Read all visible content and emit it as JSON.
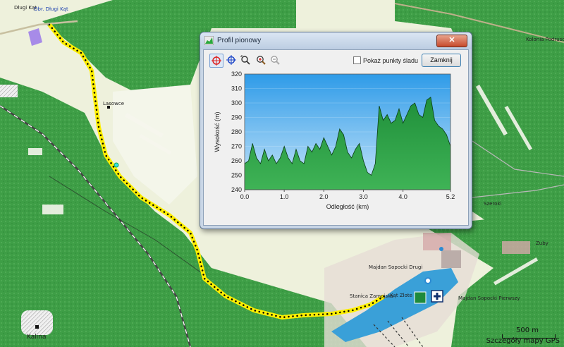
{
  "map": {
    "places": [
      {
        "name": "Długi Kąt",
        "blue": false
      },
      {
        "name": "Obr. Długi Kąt",
        "blue": true
      },
      {
        "name": "Kolonia Podrusow",
        "blue": false
      },
      {
        "name": "Lasowce",
        "blue": false
      },
      {
        "name": "Zuby",
        "blue": false
      },
      {
        "name": "Majdan Sopocki Drugi",
        "blue": false
      },
      {
        "name": "Stanica Zamojska",
        "blue": false
      },
      {
        "name": "Kąt Zlote",
        "blue": false
      },
      {
        "name": "Majdan Sopocki Pierwszy",
        "blue": false
      },
      {
        "name": "Kalina",
        "blue": false
      },
      {
        "name": "Szeroki",
        "blue": false
      }
    ],
    "scale_label": "500 m",
    "status": "Szczegóły mapy GPS"
  },
  "dialog": {
    "title": "Profil pionowy",
    "close_symbol": "✕",
    "show_points_label": "Pokaż punkty śladu",
    "show_points_checked": false,
    "close_button": "Zamknij",
    "tools": [
      "select-tool-icon",
      "pan-tool-icon",
      "zoom-box-icon",
      "zoom-in-icon",
      "zoom-out-icon"
    ]
  },
  "chart_data": {
    "type": "area",
    "xlabel": "Odległość   (km)",
    "ylabel": "Wysokość (m)",
    "xlim": [
      0,
      5.2
    ],
    "ylim": [
      240,
      320
    ],
    "xticks": [
      "0.0",
      "1.0",
      "2.0",
      "3.0",
      "4.0",
      "5.2"
    ],
    "yticks": [
      "240",
      "250",
      "260",
      "270",
      "280",
      "290",
      "300",
      "310",
      "320"
    ],
    "grid": true,
    "series": [
      {
        "x": [
          0,
          0.1,
          0.2,
          0.3,
          0.4,
          0.5,
          0.6,
          0.7,
          0.8,
          0.9,
          1.0,
          1.1,
          1.2,
          1.3,
          1.4,
          1.5,
          1.6,
          1.7,
          1.8,
          1.9,
          2.0,
          2.1,
          2.2,
          2.3,
          2.4,
          2.5,
          2.6,
          2.7,
          2.8,
          2.9,
          3.0,
          3.1,
          3.2,
          3.3,
          3.4,
          3.5,
          3.6,
          3.7,
          3.8,
          3.9,
          4.0,
          4.1,
          4.2,
          4.3,
          4.4,
          4.5,
          4.6,
          4.7,
          4.8,
          4.9,
          5.0,
          5.1,
          5.2
        ],
        "y": [
          258,
          260,
          272,
          262,
          258,
          268,
          260,
          264,
          258,
          262,
          270,
          262,
          258,
          268,
          260,
          258,
          270,
          266,
          272,
          268,
          276,
          270,
          264,
          270,
          282,
          278,
          266,
          262,
          268,
          272,
          260,
          252,
          250,
          258,
          298,
          288,
          292,
          286,
          288,
          296,
          286,
          292,
          298,
          300,
          292,
          290,
          302,
          304,
          288,
          284,
          282,
          278,
          270
        ]
      }
    ]
  }
}
